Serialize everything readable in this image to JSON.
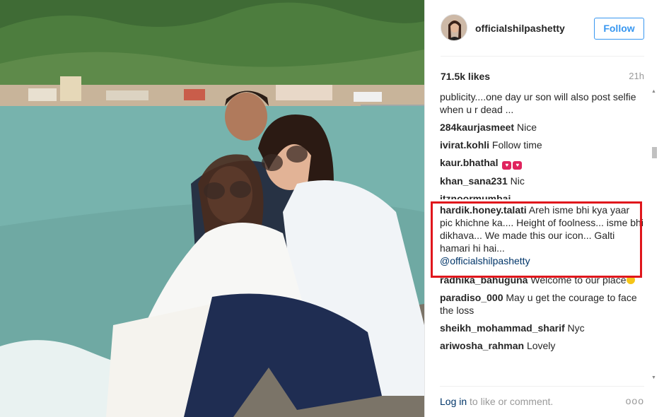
{
  "post": {
    "username": "officialshilpashetty",
    "follow_label": "Follow",
    "likes": "71.5k likes",
    "time": "21h"
  },
  "comments": [
    {
      "user": "",
      "text": "publicity....one day ur son will also post selfie when u r dead ..."
    },
    {
      "user": "284kaurjasmeet",
      "text": "Nice"
    },
    {
      "user": "ivirat.kohli",
      "text": "Follow time"
    },
    {
      "user": "kaur.bhathal",
      "text": ""
    },
    {
      "user": "khan_sana231",
      "text": "Nic"
    },
    {
      "user": "itznoormumbai",
      "text": ""
    },
    {
      "user": "hardik.honey.talati",
      "text": "Areh isme bhi kya yaar pic khichne ka.... Height of foolness... isme bhi dikhava... We made this our icon... Galti hamari hi hai...",
      "mention": "@officialshilpashetty"
    },
    {
      "user": "radhika_bahuguna",
      "text": "Welcome to our place"
    },
    {
      "user": "paradiso_000",
      "text": "May u get the courage to face the loss"
    },
    {
      "user": "sheikh_mohammad_sharif",
      "text": "Nyc"
    },
    {
      "user": "ariwosha_rahman",
      "text": "Lovely"
    }
  ],
  "footer": {
    "login_link": "Log in",
    "login_rest": " to like or comment.",
    "more": "ooo"
  },
  "colors": {
    "accent": "#3897f0",
    "highlight": "#e0161c",
    "link": "#003569"
  }
}
